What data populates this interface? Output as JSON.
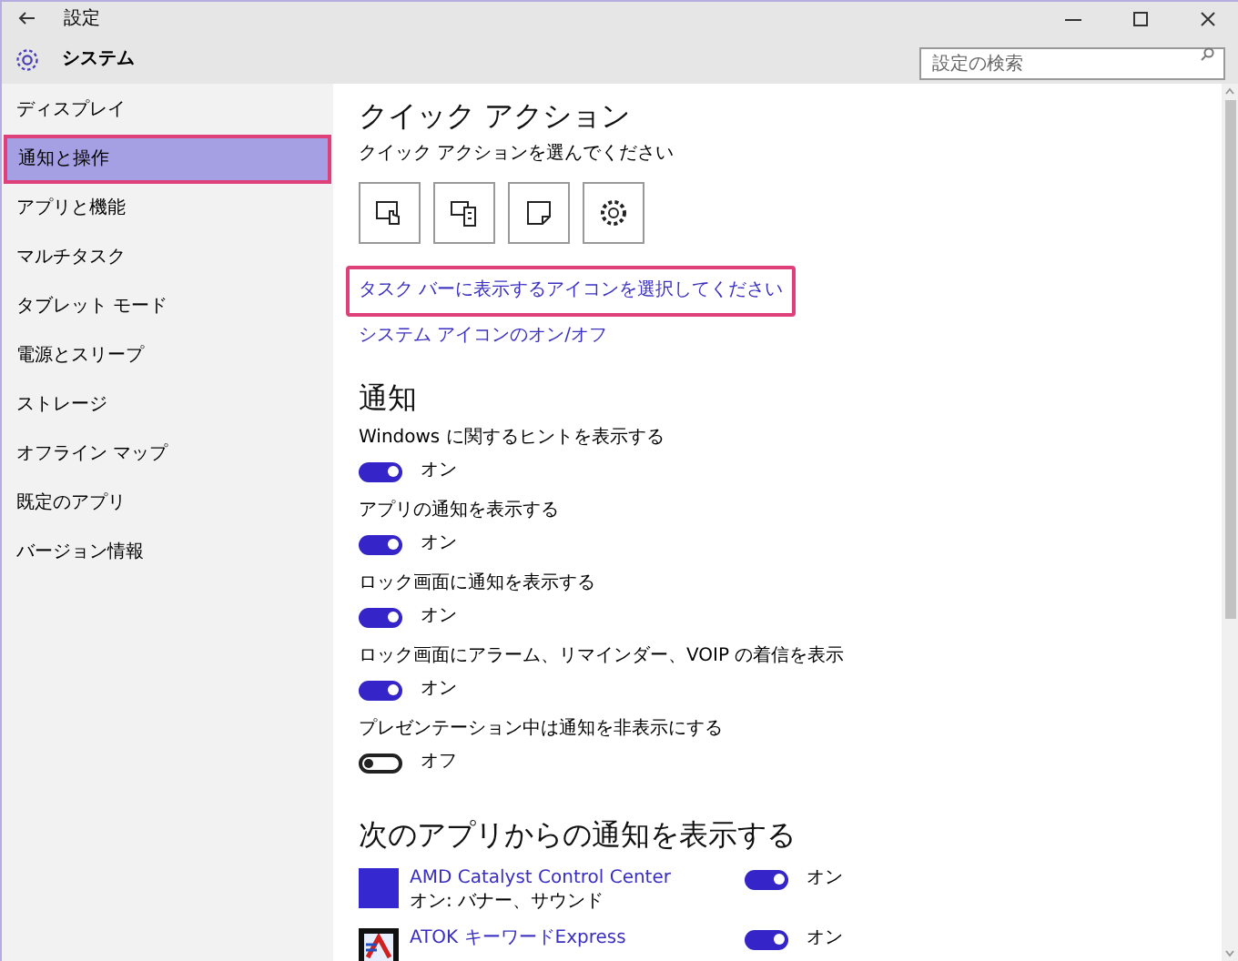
{
  "window": {
    "title": "設定"
  },
  "header": {
    "title": "システム",
    "search": {
      "placeholder": "設定の検索"
    }
  },
  "sidebar": {
    "items": [
      {
        "label": "ディスプレイ",
        "selected": false
      },
      {
        "label": "通知と操作",
        "selected": true
      },
      {
        "label": "アプリと機能",
        "selected": false
      },
      {
        "label": "マルチタスク",
        "selected": false
      },
      {
        "label": "タブレット モード",
        "selected": false
      },
      {
        "label": "電源とスリープ",
        "selected": false
      },
      {
        "label": "ストレージ",
        "selected": false
      },
      {
        "label": "オフライン マップ",
        "selected": false
      },
      {
        "label": "既定のアプリ",
        "selected": false
      },
      {
        "label": "バージョン情報",
        "selected": false
      }
    ]
  },
  "quick_actions": {
    "title": "クイック アクション",
    "subtitle": "クイック アクションを選んでください",
    "tiles": [
      {
        "kind": "tablet"
      },
      {
        "kind": "project"
      },
      {
        "kind": "note"
      },
      {
        "kind": "settings"
      }
    ],
    "links": [
      {
        "label": "タスク バーに表示するアイコンを選択してください",
        "highlighted": true
      },
      {
        "label": "システム アイコンのオン/オフ",
        "highlighted": false
      }
    ]
  },
  "notifications": {
    "title": "通知",
    "settings": [
      {
        "label": "Windows に関するヒントを表示する",
        "on": true,
        "state": "オン"
      },
      {
        "label": "アプリの通知を表示する",
        "on": true,
        "state": "オン"
      },
      {
        "label": "ロック画面に通知を表示する",
        "on": true,
        "state": "オン"
      },
      {
        "label": "ロック画面にアラーム、リマインダー、VOIP の着信を表示",
        "on": true,
        "state": "オン"
      },
      {
        "label": "プレゼンテーション中は通知を非表示にする",
        "on": false,
        "state": "オフ"
      }
    ]
  },
  "apps": {
    "title": "次のアプリからの通知を表示する",
    "items": [
      {
        "name": "AMD Catalyst Control Center",
        "detail": "オン: バナー、サウンド",
        "on": true,
        "state": "オン",
        "kind": "square"
      },
      {
        "name": "ATOK キーワードExpress",
        "on": true,
        "state": "オン",
        "kind": "atok"
      }
    ]
  }
}
